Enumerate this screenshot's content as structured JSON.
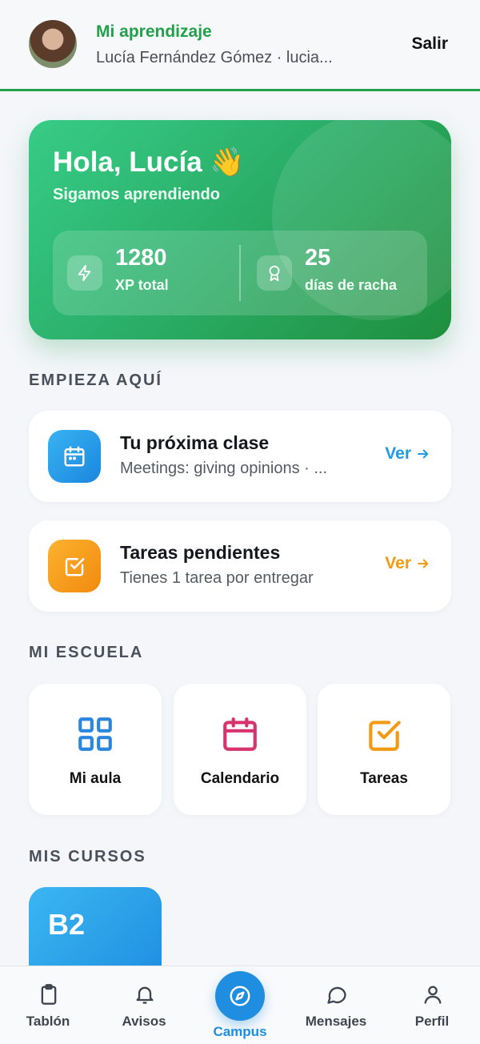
{
  "header": {
    "title": "Mi aprendizaje",
    "subtitle": "Lucía Fernández Gómez · lucia...",
    "logout_label": "Salir"
  },
  "hero": {
    "greeting": "Hola, Lucía 👋",
    "subtitle": "Sigamos aprendiendo",
    "xp_value": "1280",
    "xp_label": "XP total",
    "streak_value": "25",
    "streak_label": "días de racha"
  },
  "sections": {
    "start_here": "EMPIEZA AQUÍ",
    "my_school": "MI ESCUELA",
    "my_courses": "MIS CURSOS"
  },
  "start_cards": [
    {
      "title": "Tu próxima clase",
      "subtitle": "Meetings: giving opinions · ...",
      "link": "Ver",
      "color": "#1f9be6"
    },
    {
      "title": "Tareas pendientes",
      "subtitle": "Tienes 1 tarea por entregar",
      "link": "Ver",
      "color": "#f39a12"
    }
  ],
  "school_tiles": [
    {
      "label": "Mi aula",
      "icon": "grid-icon",
      "color": "#2a86dd"
    },
    {
      "label": "Calendario",
      "icon": "calendar-icon",
      "color": "#d6336c"
    },
    {
      "label": "Tareas",
      "icon": "checkbox-icon",
      "color": "#f39a12"
    }
  ],
  "courses": [
    {
      "level": "B2"
    }
  ],
  "nav": {
    "items": [
      {
        "label": "Tablón",
        "icon": "clipboard-icon"
      },
      {
        "label": "Avisos",
        "icon": "bell-icon"
      },
      {
        "label": "Campus",
        "icon": "compass-icon",
        "active": true
      },
      {
        "label": "Mensajes",
        "icon": "chat-icon"
      },
      {
        "label": "Perfil",
        "icon": "user-icon"
      }
    ],
    "active_color": "#1f8ee0"
  },
  "colors": {
    "brand_green": "#22a04a",
    "blue": "#1f9be6",
    "orange": "#f39a12"
  }
}
